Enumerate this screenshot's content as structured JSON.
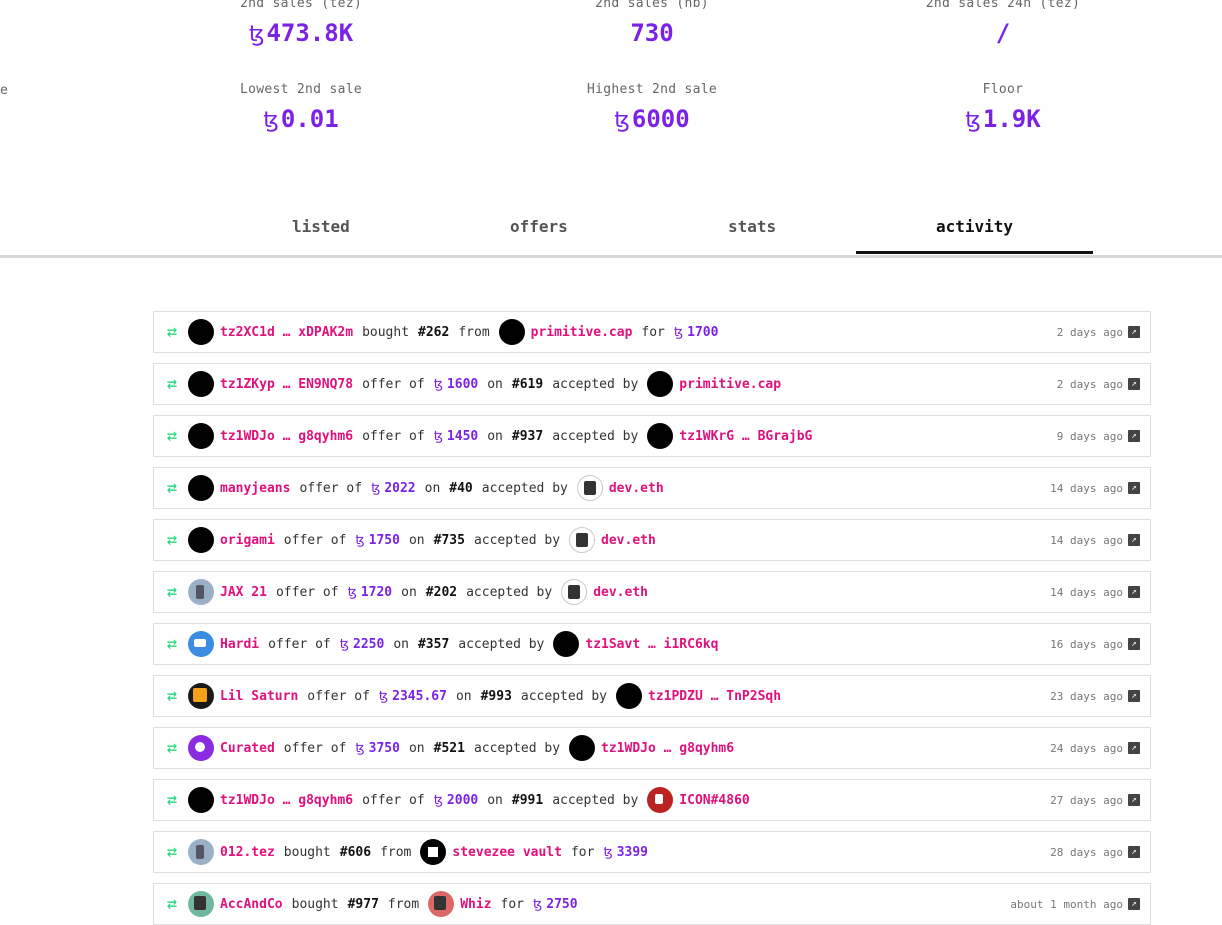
{
  "currency_symbol": "ꜩ",
  "stats": {
    "cut_label": "e",
    "sales_tez": {
      "label": "2nd sales (tez)",
      "value": "473.8K"
    },
    "sales_nb": {
      "label": "2nd sales (nb)",
      "value": "730"
    },
    "sales_24h": {
      "label": "2nd sales 24h (tez)",
      "value": "/"
    },
    "lowest": {
      "label": "Lowest 2nd sale",
      "value": "0.01"
    },
    "highest": {
      "label": "Highest 2nd sale",
      "value": "6000"
    },
    "floor": {
      "label": "Floor",
      "value": "1.9K"
    }
  },
  "tabs": [
    "listed",
    "offers",
    "stats",
    "activity"
  ],
  "active_tab": "activity",
  "words": {
    "bought": "bought",
    "from": "from",
    "for": "for",
    "offer_of": "offer of",
    "on": "on",
    "accepted_by": "accepted by"
  },
  "activity": [
    {
      "type": "bought",
      "buyer": "tz2XC1d … xDPAK2m",
      "token": "#262",
      "seller": "primitive.cap",
      "price": "1700",
      "time": "2 days ago"
    },
    {
      "type": "offer",
      "offerer": "tz1ZKyp … EN9NQ78",
      "price": "1600",
      "token": "#619",
      "acceptor": "primitive.cap",
      "time": "2 days ago"
    },
    {
      "type": "offer",
      "offerer": "tz1WDJo … g8qyhm6",
      "price": "1450",
      "token": "#937",
      "acceptor": "tz1WKrG … BGrajbG",
      "time": "9 days ago"
    },
    {
      "type": "offer",
      "offerer": "manyjeans",
      "price": "2022",
      "token": "#40",
      "acceptor": "dev.eth",
      "time": "14 days ago"
    },
    {
      "type": "offer",
      "offerer": "origami",
      "price": "1750",
      "token": "#735",
      "acceptor": "dev.eth",
      "time": "14 days ago"
    },
    {
      "type": "offer",
      "offerer": "JAX 21",
      "price": "1720",
      "token": "#202",
      "acceptor": "dev.eth",
      "time": "14 days ago"
    },
    {
      "type": "offer",
      "offerer": "Hardi",
      "price": "2250",
      "token": "#357",
      "acceptor": "tz1Savt … i1RC6kq",
      "time": "16 days ago"
    },
    {
      "type": "offer",
      "offerer": "Lil Saturn",
      "price": "2345.67",
      "token": "#993",
      "acceptor": "tz1PDZU … TnP2Sqh",
      "time": "23 days ago"
    },
    {
      "type": "offer",
      "offerer": "Curated",
      "price": "3750",
      "token": "#521",
      "acceptor": "tz1WDJo … g8qyhm6",
      "time": "24 days ago"
    },
    {
      "type": "offer",
      "offerer": "tz1WDJo … g8qyhm6",
      "price": "2000",
      "token": "#991",
      "acceptor": "ICON#4860",
      "time": "27 days ago"
    },
    {
      "type": "bought",
      "buyer": "012.tez",
      "token": "#606",
      "seller": "stevezee vault",
      "price": "3399",
      "time": "28 days ago"
    },
    {
      "type": "bought",
      "buyer": "AccAndCo",
      "token": "#977",
      "seller": "Whiz",
      "price": "2750",
      "time": "about 1 month ago"
    }
  ]
}
